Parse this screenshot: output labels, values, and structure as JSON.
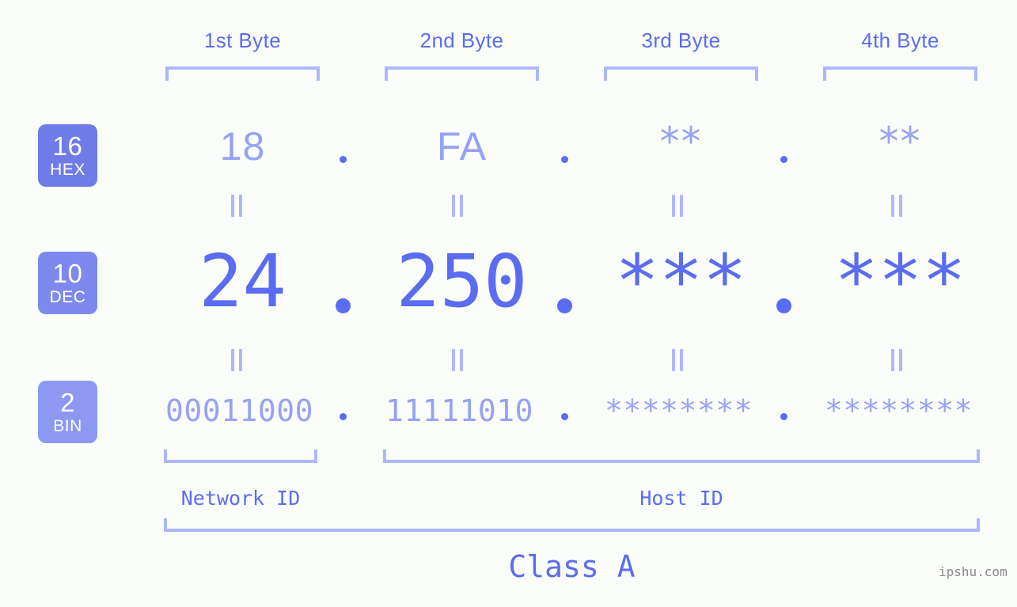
{
  "page": {
    "background_color": "#fbfdfa",
    "accent_color": "#5a6cf0",
    "accent_light_color": "#97a2f5",
    "bracket_color": "#aeb7fb"
  },
  "byte_headers": [
    {
      "label": "1st Byte"
    },
    {
      "label": "2nd Byte"
    },
    {
      "label": "3rd Byte"
    },
    {
      "label": "4th Byte"
    }
  ],
  "rows": [
    {
      "base": "16",
      "abbr": "HEX",
      "badge_color": "#6f7ce8",
      "values": [
        "18",
        "FA",
        "**",
        "**"
      ]
    },
    {
      "base": "10",
      "abbr": "DEC",
      "badge_color": "#7d89ec",
      "values": [
        "24",
        "250",
        "***",
        "***"
      ]
    },
    {
      "base": "2",
      "abbr": "BIN",
      "badge_color": "#8c98f2",
      "values": [
        "00011000",
        "11111010",
        "********",
        "********"
      ]
    }
  ],
  "separators": {
    "dot": "."
  },
  "equality_marks": {
    "glyph": "="
  },
  "id_sections": [
    {
      "label": "Network ID"
    },
    {
      "label": "Host ID"
    }
  ],
  "class_section": {
    "label": "Class A"
  },
  "watermark": {
    "text": "ipshu.com"
  }
}
